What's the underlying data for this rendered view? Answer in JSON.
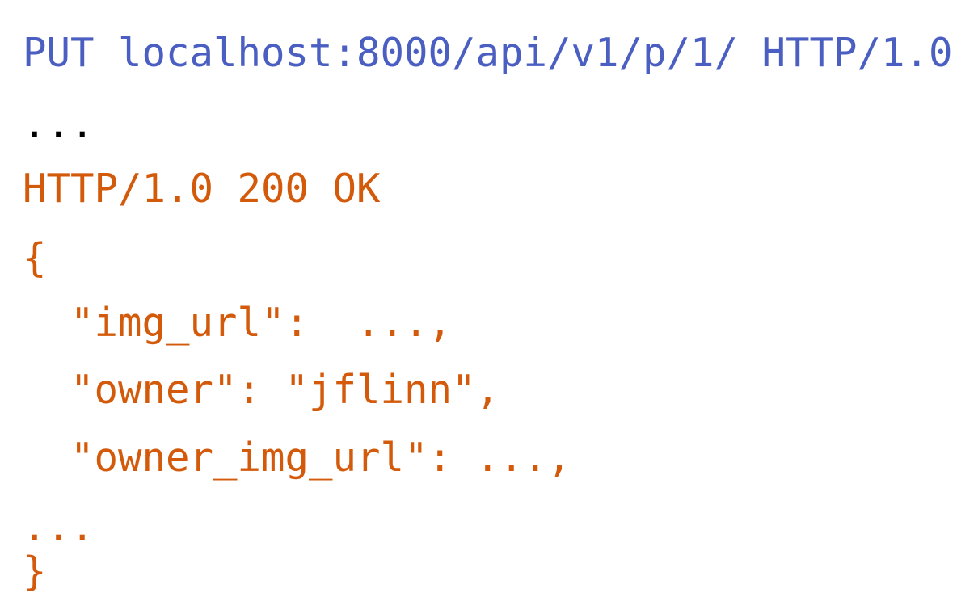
{
  "colors": {
    "request": "#4a5fc1",
    "neutral": "#000000",
    "response": "#d35a0a"
  },
  "request": {
    "line": "PUT localhost:8000/api/v1/p/1/ HTTP/1.0",
    "elided": "..."
  },
  "response": {
    "status_line": "HTTP/1.0 200 OK",
    "open_brace": "{",
    "fields": [
      "  \"img_url\":  ...,",
      "  \"owner\": \"jflinn\",",
      "  \"owner_img_url\": ...,"
    ],
    "elided": "...",
    "close_brace": "}"
  }
}
